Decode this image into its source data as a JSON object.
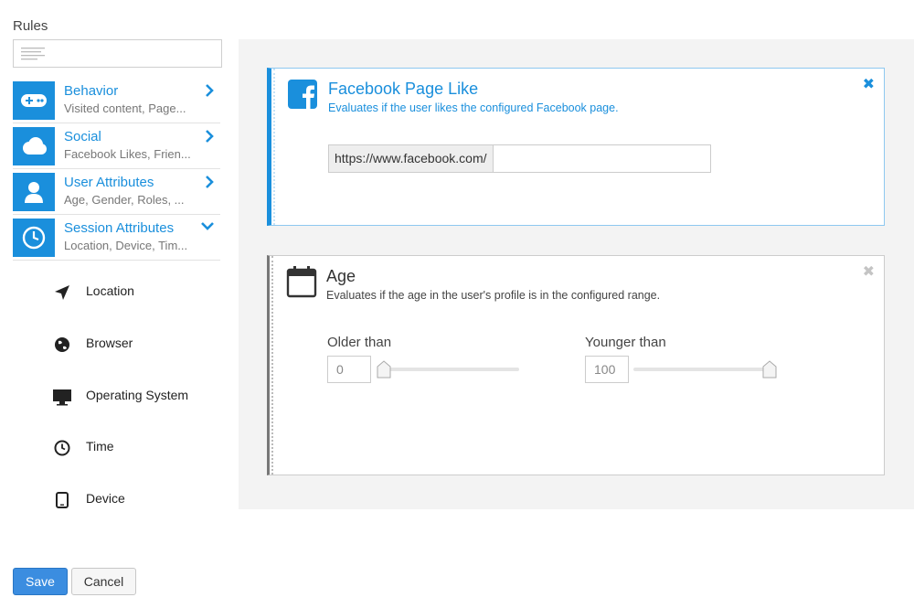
{
  "sidebar": {
    "title": "Rules",
    "search": {
      "value": "",
      "icon": "text-lines-icon"
    },
    "categories": [
      {
        "title": "Behavior",
        "description": "Visited content, Page...",
        "icon": "gamepad-icon",
        "expanded": false
      },
      {
        "title": "Social",
        "description": "Facebook Likes, Frien...",
        "icon": "cloud-icon",
        "expanded": false
      },
      {
        "title": "User Attributes",
        "description": "Age, Gender, Roles, ...",
        "icon": "user-icon",
        "expanded": false
      },
      {
        "title": "Session Attributes",
        "description": "Location, Device, Tim...",
        "icon": "clock-icon",
        "expanded": true
      }
    ],
    "session_items": [
      {
        "label": "Location",
        "icon": "location-arrow-icon"
      },
      {
        "label": "Browser",
        "icon": "globe-icon"
      },
      {
        "label": "Operating System",
        "icon": "monitor-icon"
      },
      {
        "label": "Time",
        "icon": "clock-icon"
      },
      {
        "label": "Device",
        "icon": "tablet-icon"
      }
    ]
  },
  "rules": {
    "facebook": {
      "title": "Facebook Page Like",
      "description": "Evaluates if the user likes the configured Facebook page.",
      "url_prefix": "https://www.facebook.com/",
      "url_value": "",
      "close": "✖"
    },
    "age": {
      "title": "Age",
      "description": "Evaluates if the age in the user's profile is in the configured range.",
      "older_label": "Older than",
      "older_value": "0",
      "younger_label": "Younger than",
      "younger_value": "100",
      "close": "✖"
    }
  },
  "footer": {
    "save_label": "Save",
    "cancel_label": "Cancel"
  },
  "colors": {
    "accent": "#1a8fdc",
    "save_button": "#3b8de0",
    "canvas_bg": "#f3f3f3"
  }
}
